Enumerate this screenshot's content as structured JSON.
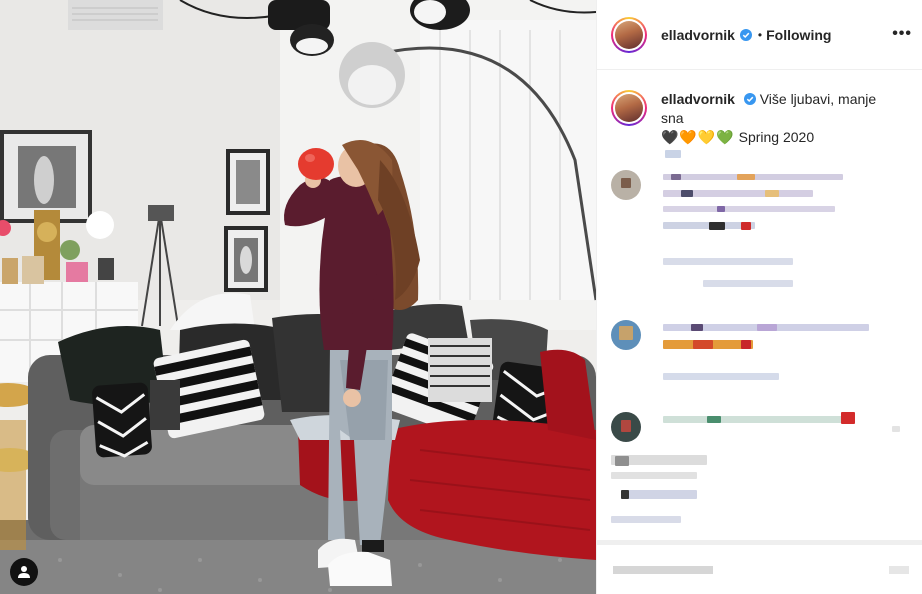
{
  "post": {
    "username": "elladvornik",
    "follow_status": "Following",
    "separator": "•",
    "more": "•••",
    "caption_text": "Više ljubavi, manje sna",
    "caption_hearts": "🖤🧡💛💚",
    "caption_tail": "Spring 2020"
  },
  "colors": {
    "verified_badge": "#3897f0",
    "text": "#262626",
    "shirt": "#5a1c2e",
    "throw": "#b1151e",
    "balloon": "#e53b2f"
  },
  "icons": {
    "tag": "user-tag-icon",
    "verified": "verified-badge-icon",
    "more": "more-options-icon"
  }
}
